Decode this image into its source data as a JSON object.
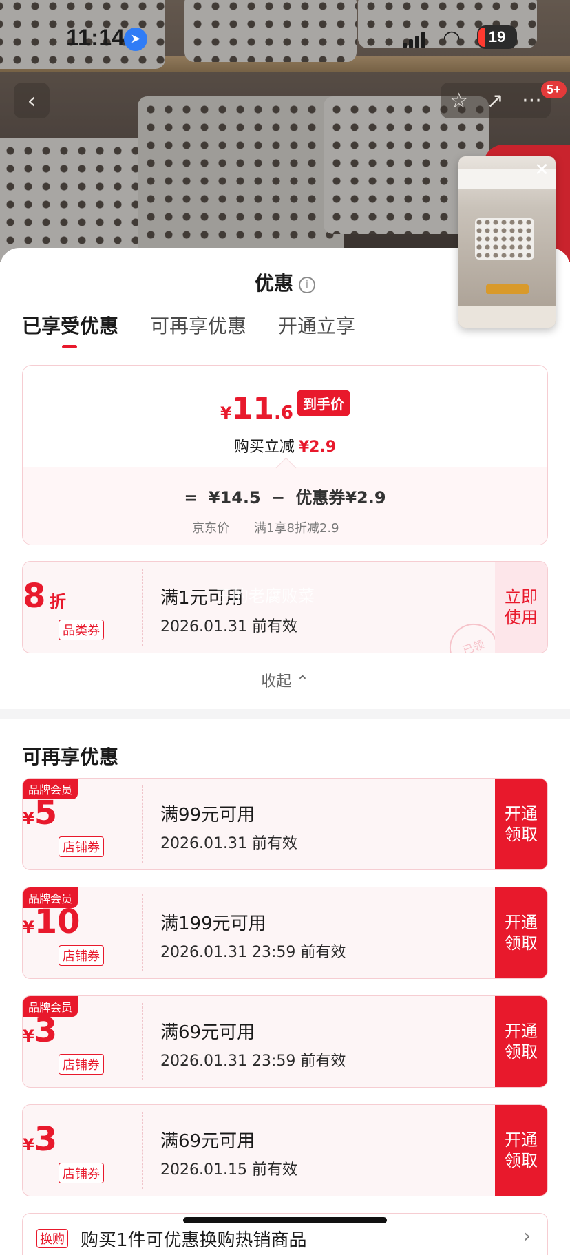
{
  "status_bar": {
    "time": "11:14",
    "battery": "19"
  },
  "nav": {
    "back_icon": "‹",
    "star_icon": "☆",
    "share_icon": "↗",
    "more_icon": "···",
    "badge": "5+"
  },
  "video": {
    "close": "✕"
  },
  "sheet": {
    "title": "优惠",
    "info_icon": "i",
    "tabs": [
      {
        "label": "已享受优惠",
        "active": true
      },
      {
        "label": "可再享优惠",
        "active": false
      },
      {
        "label": "开通立享",
        "active": false
      }
    ]
  },
  "price": {
    "currency": "¥",
    "final_int": "11",
    "final_dec": ".6",
    "final_tag": "到手价",
    "reduce_label": "购买立减",
    "reduce_amount": "¥2.9",
    "formula_eq": "=",
    "jd_price": "¥14.5",
    "minus": "−",
    "coupon_part": "优惠券¥2.9",
    "jd_price_label": "京东价",
    "coupon_part_label": "满1享8折减2.9"
  },
  "enjoyed_coupon": {
    "value": "8",
    "unit": "折",
    "kind": "品类券",
    "condition": "满1元可用",
    "expiry": "2026.01.31 前有效",
    "action": "立即\n使用",
    "stamp": "已领",
    "watermark": "王的老腐败菜"
  },
  "collapse": {
    "label": "收起",
    "icon": "⌃"
  },
  "more_section": {
    "title": "可再享优惠"
  },
  "coupons": [
    {
      "member": "品牌会员",
      "currency": "¥",
      "value": "5",
      "kind": "店铺券",
      "condition": "满99元可用",
      "expiry": "2026.01.31 前有效",
      "action": "开通\n领取"
    },
    {
      "member": "品牌会员",
      "currency": "¥",
      "value": "10",
      "kind": "店铺券",
      "condition": "满199元可用",
      "expiry": "2026.01.31 23:59 前有效",
      "action": "开通\n领取"
    },
    {
      "member": "品牌会员",
      "currency": "¥",
      "value": "3",
      "kind": "店铺券",
      "condition": "满69元可用",
      "expiry": "2026.01.31 23:59 前有效",
      "action": "开通\n领取"
    },
    {
      "member": "",
      "currency": "¥",
      "value": "3",
      "kind": "店铺券",
      "condition": "满69元可用",
      "expiry": "2026.01.15 前有效",
      "action": "开通\n领取"
    }
  ],
  "bottom_item": {
    "tag": "换购",
    "text": "购买1件可优惠换购热销商品",
    "arrow": "›"
  },
  "colors": {
    "accent": "#e8192c",
    "border": "#f6cdd2"
  }
}
